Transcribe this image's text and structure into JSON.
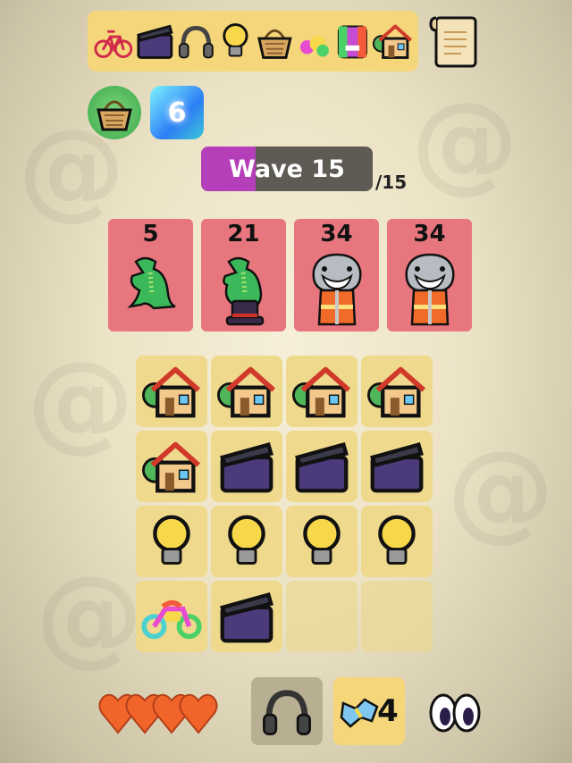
{
  "inventory": {
    "items": [
      "bicycle-icon",
      "clapperboard-icon",
      "headphones-icon",
      "lightbulb-icon",
      "basket-icon",
      "rainbow-blob-icon",
      "rainbow-building-icon",
      "house-icon"
    ]
  },
  "equipped": {
    "items": [
      "basket-icon",
      "crystal-icon"
    ],
    "crystal_value": "6"
  },
  "wave": {
    "label": "Wave 15",
    "total": "/15",
    "progress": 0.32
  },
  "enemies": [
    {
      "count": "5",
      "type": "crocodile-icon"
    },
    {
      "count": "21",
      "type": "crocodile-hat-icon"
    },
    {
      "count": "34",
      "type": "shark-vest-icon"
    },
    {
      "count": "34",
      "type": "shark-vest-icon"
    }
  ],
  "board": [
    [
      "house-icon",
      "house-icon",
      "house-icon",
      "house-icon"
    ],
    [
      "house-icon",
      "clapperboard-icon",
      "clapperboard-icon",
      "clapperboard-icon"
    ],
    [
      "lightbulb-icon",
      "lightbulb-icon",
      "lightbulb-icon",
      "lightbulb-icon"
    ],
    [
      "rainbow-motorcycle-icon",
      "clapperboard-icon",
      "",
      ""
    ]
  ],
  "status": {
    "lives": 4,
    "bonus_count": "4"
  },
  "colors": {
    "wave_fill": "#b43fb8",
    "enemy_card": "#e8767e",
    "cell": "#efd98c",
    "heart": "#f2652a"
  }
}
